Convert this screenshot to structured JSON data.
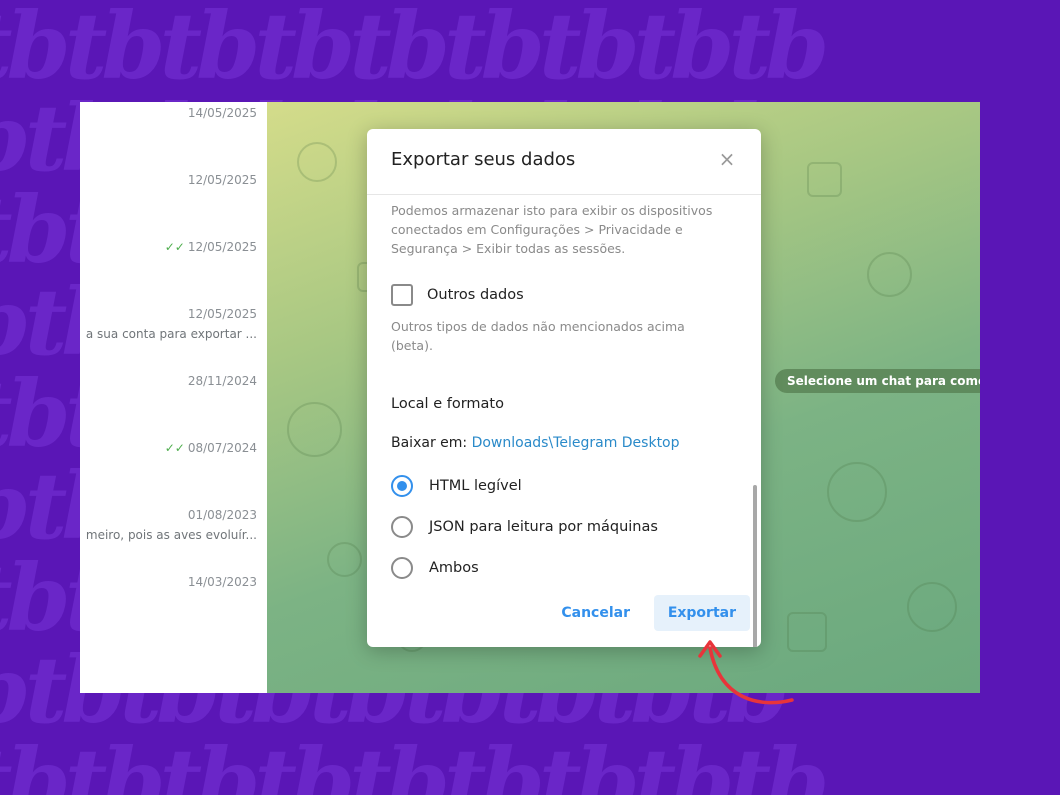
{
  "chat_list": {
    "rows": [
      {
        "date": "14/05/2025",
        "read": false,
        "snippet": ""
      },
      {
        "date": "12/05/2025",
        "read": false,
        "snippet": ""
      },
      {
        "date": "12/05/2025",
        "read": true,
        "snippet": ""
      },
      {
        "date": "12/05/2025",
        "read": false,
        "snippet": "a sua conta para exportar ..."
      },
      {
        "date": "28/11/2024",
        "read": false,
        "snippet": ""
      },
      {
        "date": "08/07/2024",
        "read": true,
        "snippet": ""
      },
      {
        "date": "01/08/2023",
        "read": false,
        "snippet": "meiro, pois as aves evoluír..."
      },
      {
        "date": "14/03/2023",
        "read": false,
        "snippet": ""
      }
    ],
    "read_mark": "✓✓"
  },
  "chat_area": {
    "placeholder": "Selecione um chat para come"
  },
  "dialog": {
    "title": "Exportar seus dados",
    "close_icon": "×",
    "sessions_desc": "Podemos armazenar isto para exibir os dispositivos conectados em Configurações > Privacidade e Segurança > Exibir todas as sessões.",
    "other_data_label": "Outros dados",
    "other_data_checked": false,
    "other_data_desc": "Outros tipos de dados não mencionados acima (beta).",
    "section_title": "Local e formato",
    "download_label": "Baixar em:",
    "download_path": "Downloads\\Telegram Desktop",
    "formats": [
      {
        "label": "HTML legível",
        "selected": true
      },
      {
        "label": "JSON para leitura por máquinas",
        "selected": false
      },
      {
        "label": "Ambos",
        "selected": false
      }
    ],
    "cancel_label": "Cancelar",
    "export_label": "Exportar"
  },
  "colors": {
    "background": "#5a16b6",
    "accent": "#3390ec",
    "annotation_arrow": "#e8343a"
  }
}
